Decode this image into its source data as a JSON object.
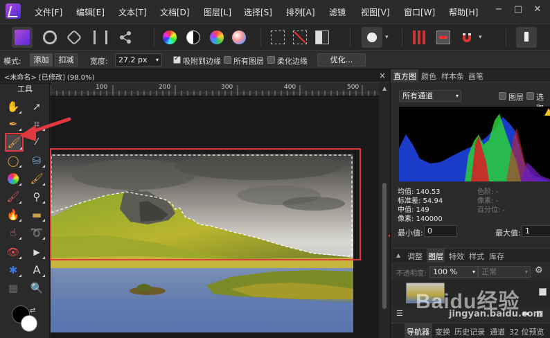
{
  "menu": {
    "items": [
      "文件[F]",
      "编辑[E]",
      "文本[T]",
      "文档[D]",
      "图层[L]",
      "选择[S]",
      "排列[A]",
      "滤镜",
      "视图[V]",
      "窗口[W]",
      "帮助[H]"
    ],
    "minimize": "−",
    "maximize": "□",
    "close": "✕"
  },
  "context_bar": {
    "mode_label": "模式:",
    "add_label": "添加",
    "subtract_label": "扣减",
    "width_label": "宽度:",
    "width_value": "27.2 px",
    "snap_edges_label": "吸附到边缘",
    "all_layers_label": "所有图层",
    "soft_edges_label": "柔化边缘",
    "refine_label": "优化..."
  },
  "document": {
    "title": "<未命名> [已修改] (98.0%)",
    "close": "×"
  },
  "tools_panel": {
    "title": "工具"
  },
  "ruler": {
    "ticks": [
      "100",
      "200",
      "300",
      "400",
      "500"
    ]
  },
  "right_panel": {
    "top_tabs": [
      "直方图",
      "颜色",
      "样本条",
      "画笔"
    ],
    "channel_select": "所有通道",
    "layer_check_label": "图层",
    "selection_check_label": "选取",
    "stats": {
      "mean": "均值: 140.53",
      "std": "标准差: 54.94",
      "median": "中值: 149",
      "pixels": "像素: 140000",
      "color": "色阶: -",
      "pixel_count": "像素: -",
      "percentile": "百分位: -"
    },
    "min_label": "最小值:",
    "min_value": "0",
    "max_label": "最大值:",
    "max_value": "1",
    "mid_tabs": [
      "调整",
      "图层",
      "特效",
      "样式",
      "库存"
    ],
    "opacity_label": "不透明度:",
    "opacity_value": "100 %",
    "blend_mode": "正常",
    "bottom_tabs": [
      "导航器",
      "变换",
      "历史记录",
      "通道",
      "32 位预览"
    ]
  },
  "watermark": {
    "brand": "Baidu经验",
    "url": "jingyan.baidu.com"
  }
}
